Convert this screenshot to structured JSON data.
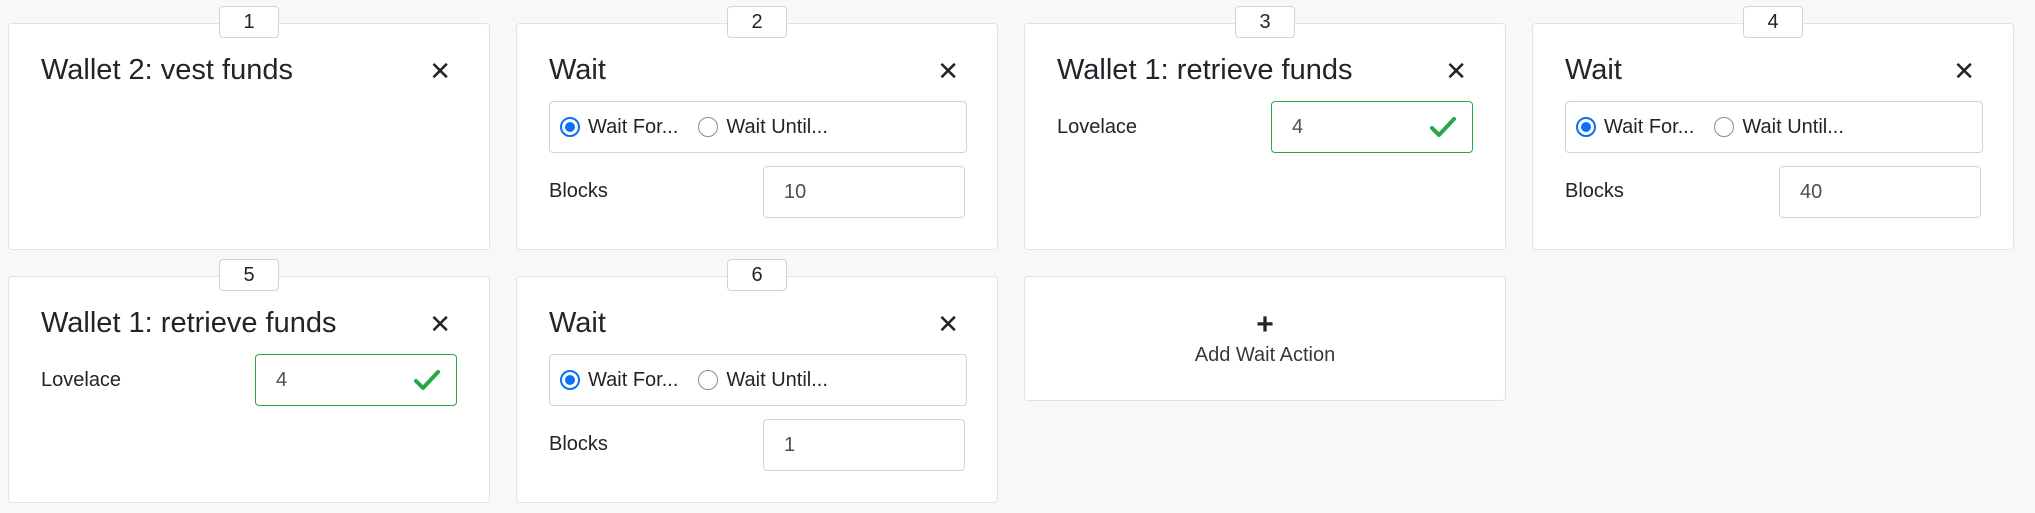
{
  "cards": [
    {
      "number": "1",
      "title": "Wallet 2: vest funds"
    },
    {
      "number": "2",
      "title": "Wait",
      "radio_for": "Wait For...",
      "radio_until": "Wait Until...",
      "field_label": "Blocks",
      "value": "10"
    },
    {
      "number": "3",
      "title": "Wallet 1: retrieve funds",
      "field_label": "Lovelace",
      "value": "4"
    },
    {
      "number": "4",
      "title": "Wait",
      "radio_for": "Wait For...",
      "radio_until": "Wait Until...",
      "field_label": "Blocks",
      "value": "40"
    },
    {
      "number": "5",
      "title": "Wallet 1: retrieve funds",
      "field_label": "Lovelace",
      "value": "4"
    },
    {
      "number": "6",
      "title": "Wait",
      "radio_for": "Wait For...",
      "radio_until": "Wait Until...",
      "field_label": "Blocks",
      "value": "1"
    }
  ],
  "add_action": {
    "label": "Add Wait Action"
  },
  "icons": {
    "close": "close-icon",
    "check": "check-icon",
    "plus": "plus-icon"
  },
  "colors": {
    "accent": "#0d6efd",
    "valid": "#28a745"
  }
}
